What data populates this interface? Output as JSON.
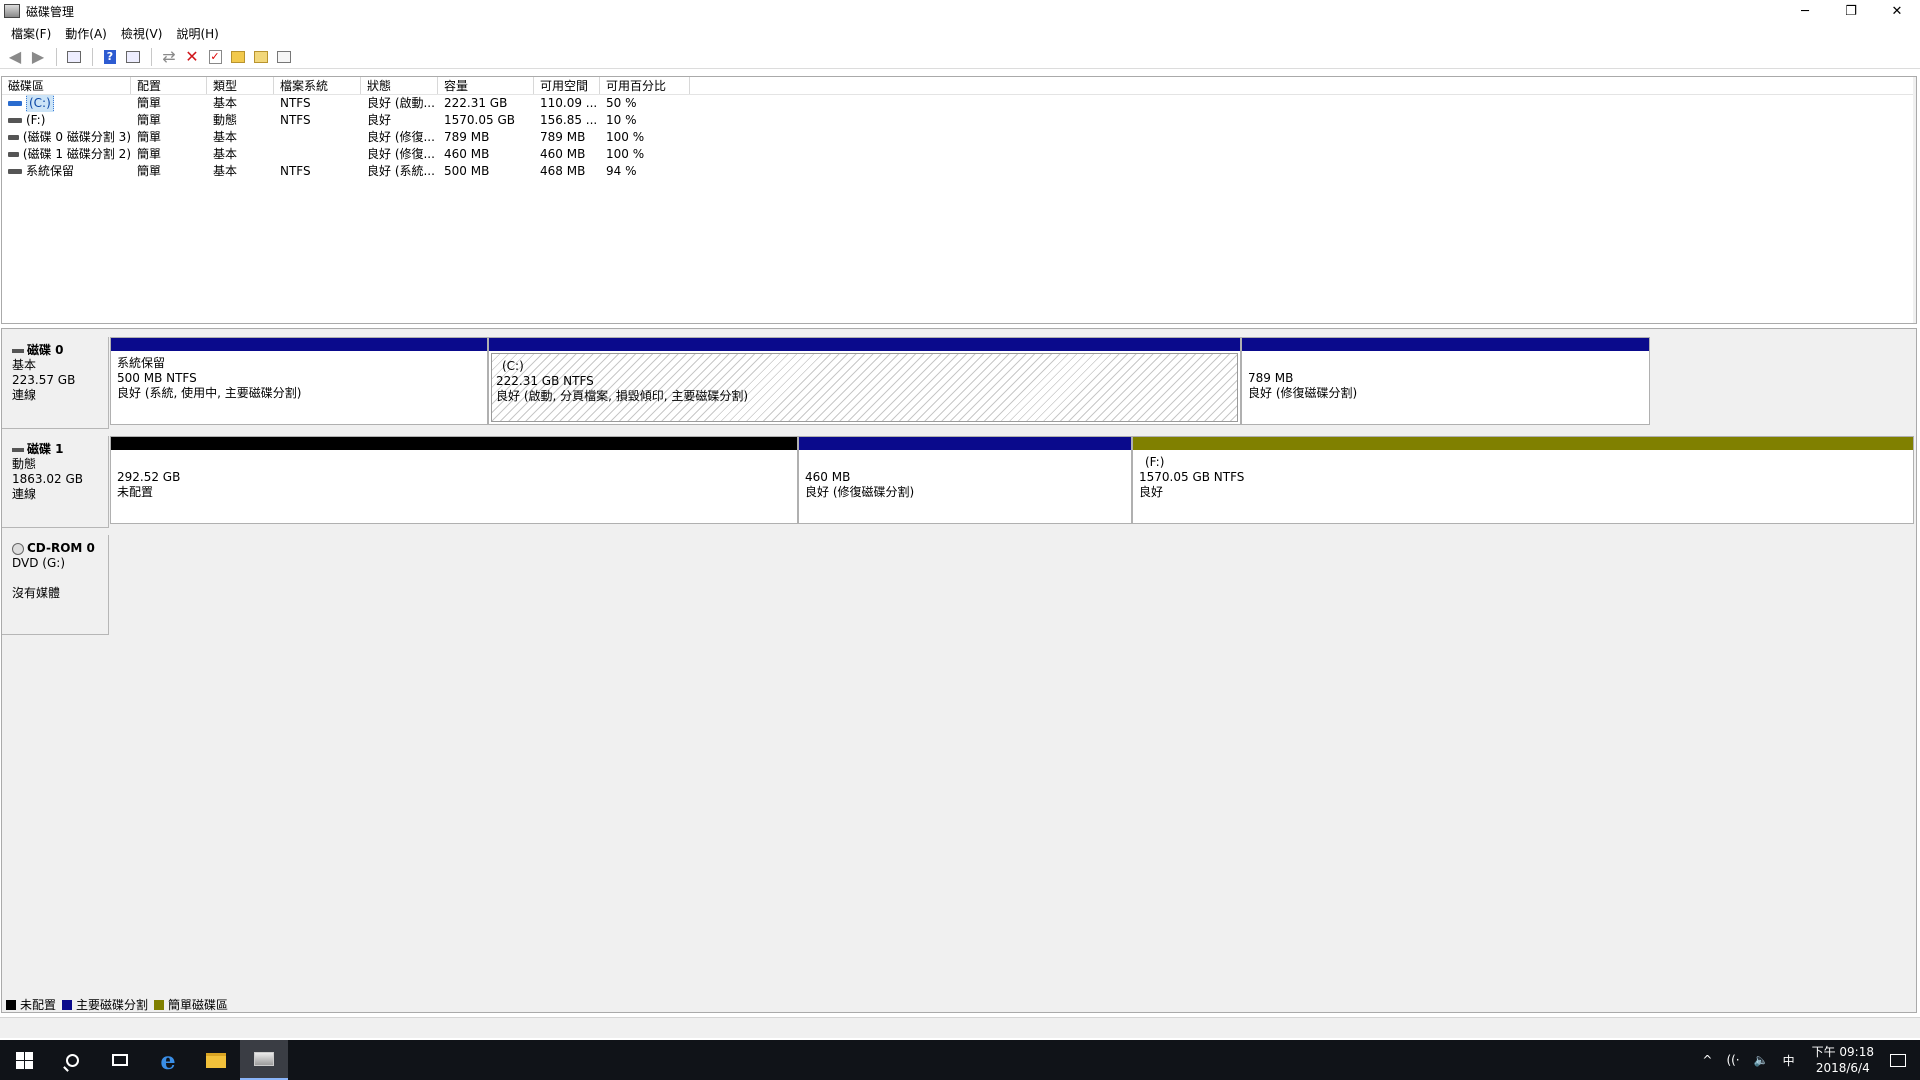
{
  "window": {
    "title": "磁碟管理",
    "minimize": "─",
    "restore": "❐",
    "close": "✕"
  },
  "menu": [
    "檔案(F)",
    "動作(A)",
    "檢視(V)",
    "說明(H)"
  ],
  "toolbar": {
    "icons": [
      "back-icon",
      "forward-icon",
      "show-hide-tree-icon",
      "help-icon",
      "console-view-icon",
      "connect-disk-icon",
      "delete-icon",
      "properties-check-icon",
      "folder-up-icon",
      "folder-search-icon",
      "properties-icon"
    ]
  },
  "volume_table": {
    "headers": [
      "磁碟區",
      "配置",
      "類型",
      "檔案系統",
      "狀態",
      "容量",
      "可用空間",
      "可用百分比"
    ],
    "rows": [
      {
        "name": "(C:)",
        "layout": "簡單",
        "type": "基本",
        "fs": "NTFS",
        "status": "良好 (啟動...",
        "capacity": "222.31 GB",
        "free": "110.09 ...",
        "pct": "50 %"
      },
      {
        "name": "(F:)",
        "layout": "簡單",
        "type": "動態",
        "fs": "NTFS",
        "status": "良好",
        "capacity": "1570.05 GB",
        "free": "156.85 ...",
        "pct": "10 %"
      },
      {
        "name": "(磁碟 0 磁碟分割 3)",
        "layout": "簡單",
        "type": "基本",
        "fs": "",
        "status": "良好 (修復...",
        "capacity": "789 MB",
        "free": "789 MB",
        "pct": "100 %"
      },
      {
        "name": "(磁碟 1 磁碟分割 2)",
        "layout": "簡單",
        "type": "基本",
        "fs": "",
        "status": "良好 (修復...",
        "capacity": "460 MB",
        "free": "460 MB",
        "pct": "100 %"
      },
      {
        "name": "系統保留",
        "layout": "簡單",
        "type": "基本",
        "fs": "NTFS",
        "status": "良好 (系統...",
        "capacity": "500 MB",
        "free": "468 MB",
        "pct": "94 %"
      }
    ]
  },
  "disks": [
    {
      "name": "磁碟 0",
      "kind": "基本",
      "size": "223.57 GB",
      "state": "連線",
      "partitions": [
        {
          "line1": "系統保留",
          "line2": "500 MB NTFS",
          "line3": "良好 (系統, 使用中, 主要磁碟分割)",
          "bar": "primary"
        },
        {
          "line1": "(C:)",
          "line2": "222.31 GB NTFS",
          "line3": "良好 (啟動, 分頁檔案, 損毀傾印, 主要磁碟分割)",
          "bar": "primary"
        },
        {
          "line1": "",
          "line2": "789 MB",
          "line3": "良好 (修復磁碟分割)",
          "bar": "primary"
        }
      ]
    },
    {
      "name": "磁碟 1",
      "kind": "動態",
      "size": "1863.02 GB",
      "state": "連線",
      "partitions": [
        {
          "line1": "",
          "line2": "292.52 GB",
          "line3": "未配置",
          "bar": "unalloc"
        },
        {
          "line1": "",
          "line2": "460 MB",
          "line3": "良好 (修復磁碟分割)",
          "bar": "primary"
        },
        {
          "line1": "(F:)",
          "line2": "1570.05 GB NTFS",
          "line3": "良好",
          "bar": "simple"
        }
      ]
    },
    {
      "name": "CD-ROM 0",
      "kind": "DVD (G:)",
      "size": "",
      "state": "沒有媒體"
    }
  ],
  "legend": [
    {
      "label": "未配置",
      "color": "#000000"
    },
    {
      "label": "主要磁碟分割",
      "color": "#0a0a8c"
    },
    {
      "label": "簡單磁碟區",
      "color": "#808000"
    }
  ],
  "taskbar": {
    "apps": [
      "start-icon",
      "search-icon",
      "task-view-icon",
      "edge-icon",
      "file-explorer-icon",
      "disk-management-icon"
    ],
    "tray": {
      "chevron": "^",
      "network": "((·",
      "volume": "🔈",
      "ime": "中",
      "time": "下午 09:18",
      "date": "2018/6/4"
    }
  }
}
